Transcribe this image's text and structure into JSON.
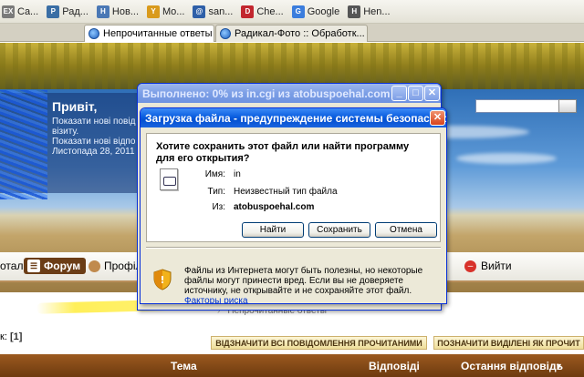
{
  "bookmarks": [
    {
      "label": "Ca...",
      "icon": "ex-icon",
      "badge": "EX",
      "color": "#7a7a7a"
    },
    {
      "label": "Рад...",
      "icon": "photo-site-icon",
      "badge": "Р",
      "color": "#3a6ea5"
    },
    {
      "label": "Нов...",
      "icon": "news-icon",
      "badge": "Н",
      "color": "#4a78b5"
    },
    {
      "label": "Mo...",
      "icon": "trophy-icon",
      "badge": "Y",
      "color": "#d99a1c"
    },
    {
      "label": "san...",
      "icon": "at-sign-icon",
      "badge": "@",
      "color": "#2e5fa8"
    },
    {
      "label": "Che...",
      "icon": "d-logo-icon",
      "badge": "D",
      "color": "#c2262e"
    },
    {
      "label": "Google",
      "icon": "google-icon",
      "badge": "G",
      "color": "#3b7ddd"
    },
    {
      "label": "Hen...",
      "icon": "hen-icon",
      "badge": "H",
      "color": "#555555"
    }
  ],
  "tabs": [
    {
      "label": "Непрочитанные ответы",
      "active": true
    },
    {
      "label": "Радикал-Фото :: Обработк...",
      "active": false
    }
  ],
  "page": {
    "greeting": "Привіт,",
    "side_lines": [
      "Показати нові повід",
      "візиту.",
      "Показати нові відпо",
      "Листопада 28, 2011"
    ],
    "nav": {
      "portal": "отал",
      "forum": "Форум",
      "profile": "Профіль",
      "logout": "Вийти"
    },
    "breadcrumb": "Непрочитанные ответы",
    "pages_label": "к:",
    "pages_value": "[1]",
    "mark_all_read": "ВІДЗНАЧИТИ ВСІ ПОВІДОМЛЕННЯ ПРОЧИТАНИМИ",
    "mark_selected_read": "ПОЗНАЧИТИ ВИДІЛЕНІ ЯК ПРОЧИТ",
    "table_headers": {
      "topic": "Тема",
      "replies": "Відповіді",
      "last_reply": "Остання відповідь"
    }
  },
  "progress_dialog": {
    "title": "Выполнено: 0% из in.cgi из atobuspoehal.com",
    "progress_percent": 0
  },
  "download_dialog": {
    "title": "Загрузка файла - предупреждение системы безопасности",
    "question": "Хотите сохранить этот файл или найти программу для его открытия?",
    "name_label": "Имя:",
    "name_value": "in",
    "type_label": "Тип:",
    "type_value": "Неизвестный тип файла",
    "from_label": "Из:",
    "from_value": "atobuspoehal.com",
    "buttons": {
      "find": "Найти",
      "save": "Сохранить",
      "cancel": "Отмена"
    },
    "warning": "Файлы из Интернета могут быть полезны, но некоторые файлы могут принести вред. Если вы не доверяете источнику, не открывайте и не сохраняйте этот файл.",
    "risk_link": "Факторы риска"
  },
  "colors": {
    "xp_title_blue": "#0a5ddf",
    "forum_brown": "#6b3d16",
    "table_header_brown": "#8a4a18",
    "link_blue": "#0033cc"
  }
}
